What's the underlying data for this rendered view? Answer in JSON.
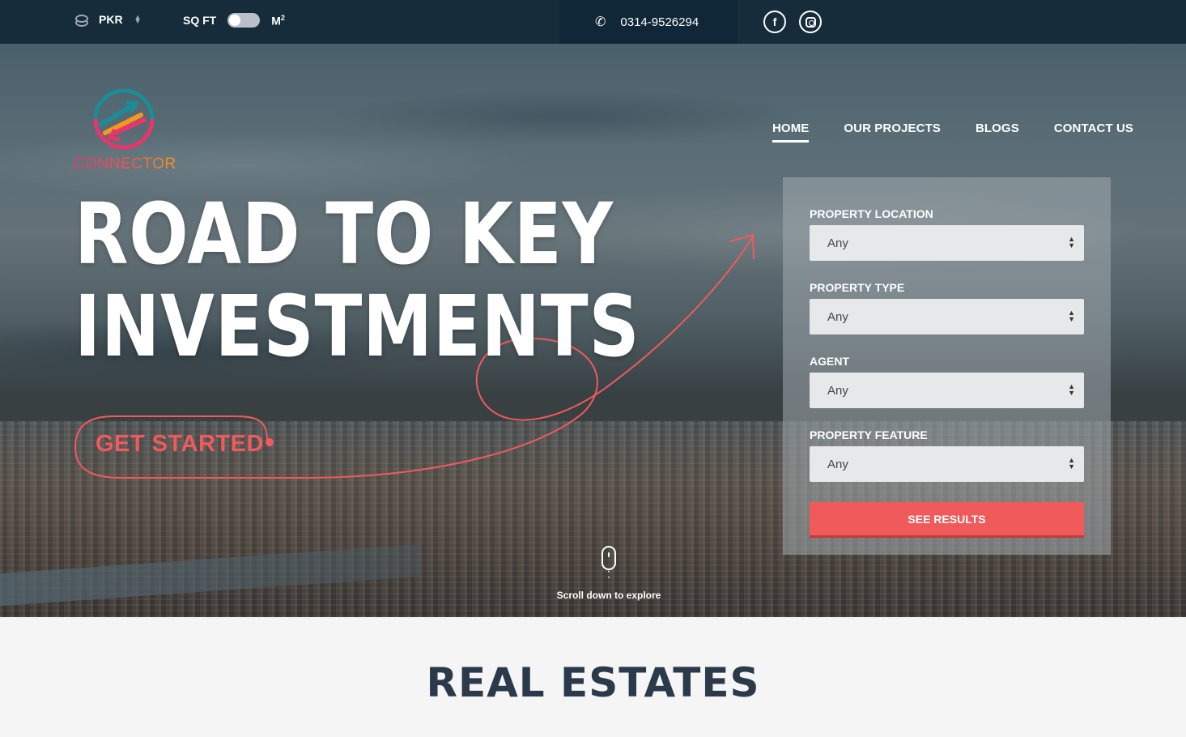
{
  "topbar": {
    "currency": "PKR",
    "unit_left": "SQ FT",
    "unit_right": "M",
    "unit_right_sup": "2",
    "phone": "0314-9526294",
    "social": [
      "facebook-icon",
      "instagram-icon"
    ]
  },
  "logo": {
    "text": "CONNECTOR"
  },
  "nav": {
    "items": [
      {
        "label": "HOME",
        "active": true
      },
      {
        "label": "OUR PROJECTS",
        "active": false
      },
      {
        "label": "BLOGS",
        "active": false
      },
      {
        "label": "CONTACT US",
        "active": false
      }
    ]
  },
  "hero": {
    "headline_line1": "ROAD TO KEY",
    "headline_line2": "INVESTMENTS",
    "cta": "GET STARTED",
    "scroll_text": "Scroll down to explore"
  },
  "search": {
    "fields": [
      {
        "label": "PROPERTY LOCATION",
        "value": "Any"
      },
      {
        "label": "PROPERTY TYPE",
        "value": "Any"
      },
      {
        "label": "AGENT",
        "value": "Any"
      },
      {
        "label": "PROPERTY FEATURE",
        "value": "Any"
      }
    ],
    "button": "SEE RESULTS"
  },
  "section": {
    "title": "REAL ESTATES"
  },
  "colors": {
    "accent": "#f05a5b",
    "topbar": "#12283a",
    "heading": "#2b3a4a"
  }
}
